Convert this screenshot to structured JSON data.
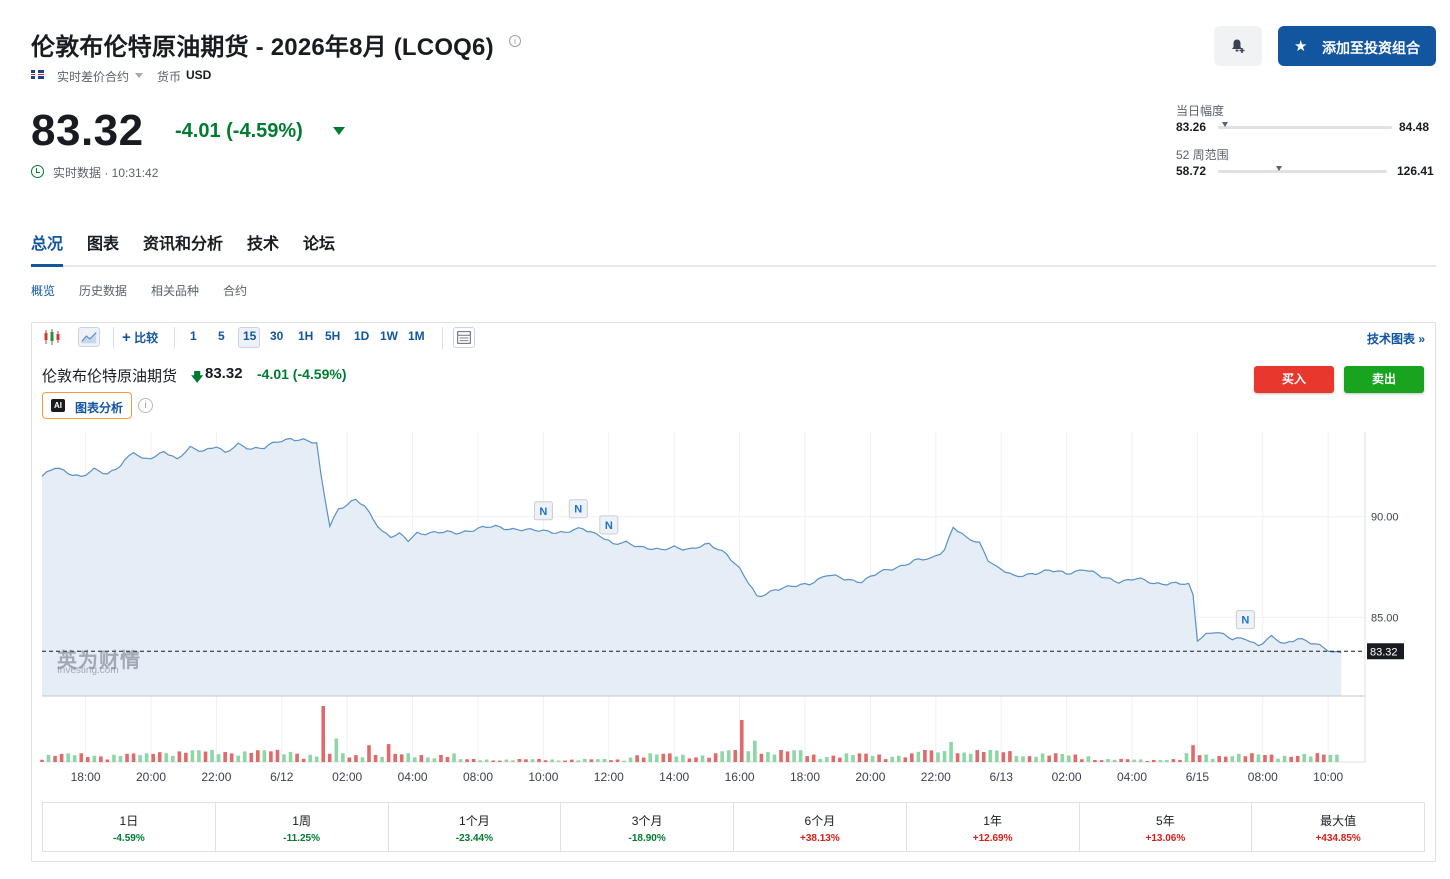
{
  "header": {
    "title": "伦敦布伦特原油期货 - 2026年8月 (LCOQ6)",
    "info_icon": "info-icon",
    "contract_type": "实时差价合约",
    "currency_label": "货币",
    "currency_value": "USD",
    "flag_icon": "uk-flag-icon"
  },
  "quote": {
    "price": "83.32",
    "change": "-4.01 (-4.59%)",
    "direction": "down",
    "realtime_text": "实时数据 · 10:31:42",
    "color_down": "#007c32",
    "color_up": "#d91e18"
  },
  "actions": {
    "alert_icon": "bell-plus-icon",
    "portfolio_label": "添加至投资组合",
    "portfolio_icon": "star-icon",
    "accent": "#1256a0"
  },
  "ranges": {
    "day": {
      "label": "当日幅度",
      "low": "83.26",
      "high": "84.48",
      "position": 0.04
    },
    "week52": {
      "label": "52 周范围",
      "low": "58.72",
      "high": "126.41",
      "position": 0.36
    }
  },
  "tabs": [
    "总况",
    "图表",
    "资讯和分析",
    "技术",
    "论坛"
  ],
  "active_tab": "总况",
  "subtabs": [
    "概览",
    "历史数据",
    "相关品种",
    "合约"
  ],
  "active_subtab": "概览",
  "toolbar": {
    "compare": "比较",
    "intervals": [
      "1",
      "5",
      "15",
      "30",
      "1H",
      "5H",
      "1D",
      "1W",
      "1M"
    ],
    "active_interval": "15",
    "tech_chart": "技术图表 »"
  },
  "chart_header": {
    "name": "伦敦布伦特原油期货",
    "arrow": "🡇",
    "price": "83.32",
    "change": "-4.01 (-4.59%)",
    "ai_label": "图表分析",
    "ai_badge": "AI",
    "buy": "买入",
    "sell": "卖出",
    "buy_color": "#e8372c",
    "sell_color": "#18a41e"
  },
  "watermark": {
    "main": "英为财情",
    "sub": "Investing.com"
  },
  "chart_data": {
    "type": "area",
    "y_ticks": [
      "90.00",
      "85.00"
    ],
    "ylim": [
      81.1,
      94.2
    ],
    "last_price_label": "83.32",
    "last_price": 83.32,
    "x_tick_labels": [
      "18:00",
      "20:00",
      "22:00",
      "6/12",
      "02:00",
      "04:00",
      "08:00",
      "10:00",
      "12:00",
      "14:00",
      "16:00",
      "18:00",
      "20:00",
      "22:00",
      "6/13",
      "02:00",
      "04:00",
      "6/15",
      "08:00",
      "10:00"
    ],
    "x_tick_index": [
      10,
      25,
      40,
      55,
      70,
      85,
      100,
      115,
      130,
      145,
      160,
      175,
      190,
      205,
      220,
      235,
      250,
      265,
      280,
      295
    ],
    "news_marker_label": "N",
    "news_markers": [
      {
        "index": 115,
        "value": 89.2
      },
      {
        "index": 123,
        "value": 89.3
      },
      {
        "index": 130,
        "value": 88.5
      },
      {
        "index": 276,
        "value": 83.8
      }
    ],
    "price_keypoints": [
      [
        0,
        92.0
      ],
      [
        3,
        92.4
      ],
      [
        6,
        92.2
      ],
      [
        9,
        92.0
      ],
      [
        12,
        92.3
      ],
      [
        15,
        92.1
      ],
      [
        18,
        92.6
      ],
      [
        21,
        93.2
      ],
      [
        23,
        92.8
      ],
      [
        26,
        93.0
      ],
      [
        28,
        93.3
      ],
      [
        31,
        92.8
      ],
      [
        34,
        93.4
      ],
      [
        37,
        93.3
      ],
      [
        40,
        93.5
      ],
      [
        42,
        93.1
      ],
      [
        45,
        93.6
      ],
      [
        48,
        93.4
      ],
      [
        51,
        93.4
      ],
      [
        54,
        93.7
      ],
      [
        57,
        93.9
      ],
      [
        60,
        93.8
      ],
      [
        63,
        93.6
      ],
      [
        64,
        92.0
      ],
      [
        66,
        89.6
      ],
      [
        68,
        90.4
      ],
      [
        70,
        90.6
      ],
      [
        72,
        90.8
      ],
      [
        74,
        90.5
      ],
      [
        76,
        89.9
      ],
      [
        78,
        89.3
      ],
      [
        80,
        89.0
      ],
      [
        82,
        89.1
      ],
      [
        84,
        88.8
      ],
      [
        86,
        89.2
      ],
      [
        90,
        89.2
      ],
      [
        95,
        89.2
      ],
      [
        100,
        89.4
      ],
      [
        104,
        89.5
      ],
      [
        108,
        89.4
      ],
      [
        112,
        89.3
      ],
      [
        116,
        89.3
      ],
      [
        120,
        89.2
      ],
      [
        124,
        89.4
      ],
      [
        128,
        89.1
      ],
      [
        131,
        88.6
      ],
      [
        134,
        88.7
      ],
      [
        138,
        88.5
      ],
      [
        142,
        88.3
      ],
      [
        145,
        88.5
      ],
      [
        149,
        88.4
      ],
      [
        153,
        88.6
      ],
      [
        157,
        88.2
      ],
      [
        160,
        87.4
      ],
      [
        164,
        86.0
      ],
      [
        168,
        86.4
      ],
      [
        172,
        86.5
      ],
      [
        176,
        86.7
      ],
      [
        180,
        87.1
      ],
      [
        184,
        86.9
      ],
      [
        188,
        86.8
      ],
      [
        192,
        87.2
      ],
      [
        196,
        87.5
      ],
      [
        200,
        87.8
      ],
      [
        204,
        87.9
      ],
      [
        207,
        88.4
      ],
      [
        209,
        89.5
      ],
      [
        212,
        88.9
      ],
      [
        215,
        88.7
      ],
      [
        217,
        87.9
      ],
      [
        219,
        87.5
      ],
      [
        223,
        87.0
      ],
      [
        227,
        87.2
      ],
      [
        231,
        87.3
      ],
      [
        235,
        87.2
      ],
      [
        239,
        87.4
      ],
      [
        243,
        87.0
      ],
      [
        247,
        86.8
      ],
      [
        251,
        86.9
      ],
      [
        255,
        86.7
      ],
      [
        259,
        86.7
      ],
      [
        263,
        86.6
      ],
      [
        264,
        86.1
      ],
      [
        265,
        83.9
      ],
      [
        267,
        84.2
      ],
      [
        269,
        84.3
      ],
      [
        271,
        84.1
      ],
      [
        273,
        83.9
      ],
      [
        276,
        84.0
      ],
      [
        279,
        83.6
      ],
      [
        282,
        84.0
      ],
      [
        285,
        83.7
      ],
      [
        288,
        84.0
      ],
      [
        291,
        83.7
      ],
      [
        294,
        83.5
      ],
      [
        296,
        83.3
      ],
      [
        298,
        83.32
      ]
    ],
    "volume_spikes": [
      {
        "index": 22,
        "value": 0.38,
        "dir": "up"
      },
      {
        "index": 65,
        "value": 1.0,
        "dir": "down"
      },
      {
        "index": 68,
        "value": 0.42,
        "dir": "up"
      },
      {
        "index": 75,
        "value": 0.3,
        "dir": "down"
      },
      {
        "index": 80,
        "value": 0.32,
        "dir": "down"
      },
      {
        "index": 160,
        "value": 0.42,
        "dir": "down"
      },
      {
        "index": 161,
        "value": 0.75,
        "dir": "down"
      },
      {
        "index": 164,
        "value": 0.38,
        "dir": "up"
      },
      {
        "index": 209,
        "value": 0.36,
        "dir": "up"
      },
      {
        "index": 264,
        "value": 0.3,
        "dir": "down"
      },
      {
        "index": 277,
        "value": 0.44,
        "dir": "down"
      }
    ],
    "grid": true,
    "series_color": "#5b8fc9",
    "fill_color": "#e5eef7",
    "vol_up": "#8fd6a6",
    "vol_down": "#e06a6a"
  },
  "performance": [
    {
      "label": "1日",
      "value": "-4.59%",
      "dir": "neg"
    },
    {
      "label": "1周",
      "value": "-11.25%",
      "dir": "neg"
    },
    {
      "label": "1个月",
      "value": "-23.44%",
      "dir": "neg"
    },
    {
      "label": "3个月",
      "value": "-18.90%",
      "dir": "neg"
    },
    {
      "label": "6个月",
      "value": "+38.13%",
      "dir": "pos"
    },
    {
      "label": "1年",
      "value": "+12.69%",
      "dir": "pos"
    },
    {
      "label": "5年",
      "value": "+13.06%",
      "dir": "pos"
    },
    {
      "label": "最大值",
      "value": "+434.85%",
      "dir": "pos"
    }
  ]
}
